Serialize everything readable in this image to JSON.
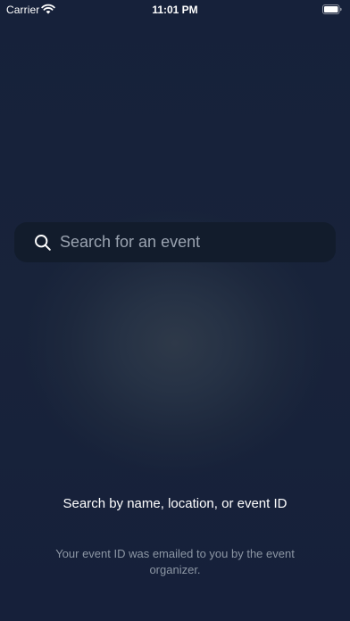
{
  "status_bar": {
    "carrier": "Carrier",
    "time": "11:01 PM"
  },
  "search": {
    "placeholder": "Search for an event",
    "value": "",
    "icon": "search-icon"
  },
  "help": {
    "title": "Search by name, location, or event ID",
    "subtitle": "Your event ID was emailed to you by the event organizer."
  },
  "colors": {
    "background": "#18233a",
    "search_field": "#121c2c",
    "placeholder": "#9aa3b0",
    "subtitle": "#8c96a4"
  }
}
